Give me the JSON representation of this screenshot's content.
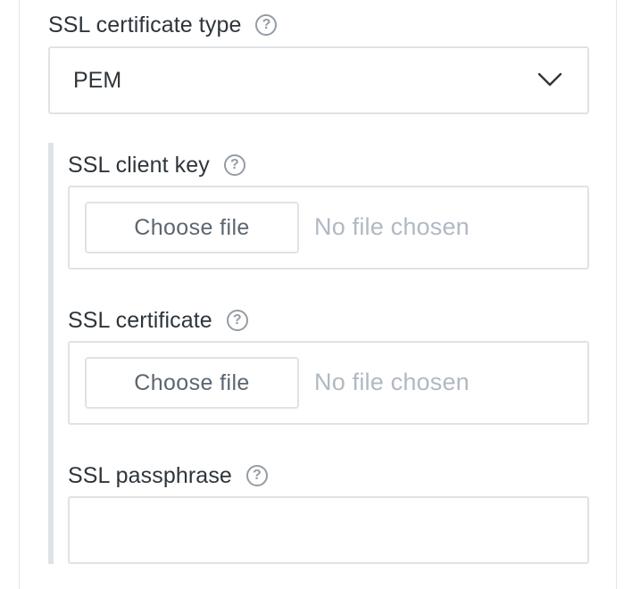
{
  "ssl_certificate_type": {
    "label": "SSL certificate type",
    "help_icon": "question-circle-icon",
    "selected_value": "PEM",
    "chevron_icon": "chevron-down-icon"
  },
  "ssl_client_key": {
    "label": "SSL client key",
    "help_icon": "question-circle-icon",
    "button_label": "Choose file",
    "status_text": "No file chosen"
  },
  "ssl_certificate": {
    "label": "SSL certificate",
    "help_icon": "question-circle-icon",
    "button_label": "Choose file",
    "status_text": "No file chosen"
  },
  "ssl_passphrase": {
    "label": "SSL passphrase",
    "help_icon": "question-circle-icon",
    "value": ""
  },
  "help_glyph": "?",
  "colors": {
    "text": "#2e353b",
    "border": "#dfe3e8",
    "muted": "#b0b9c3",
    "icon": "#949ca4"
  }
}
